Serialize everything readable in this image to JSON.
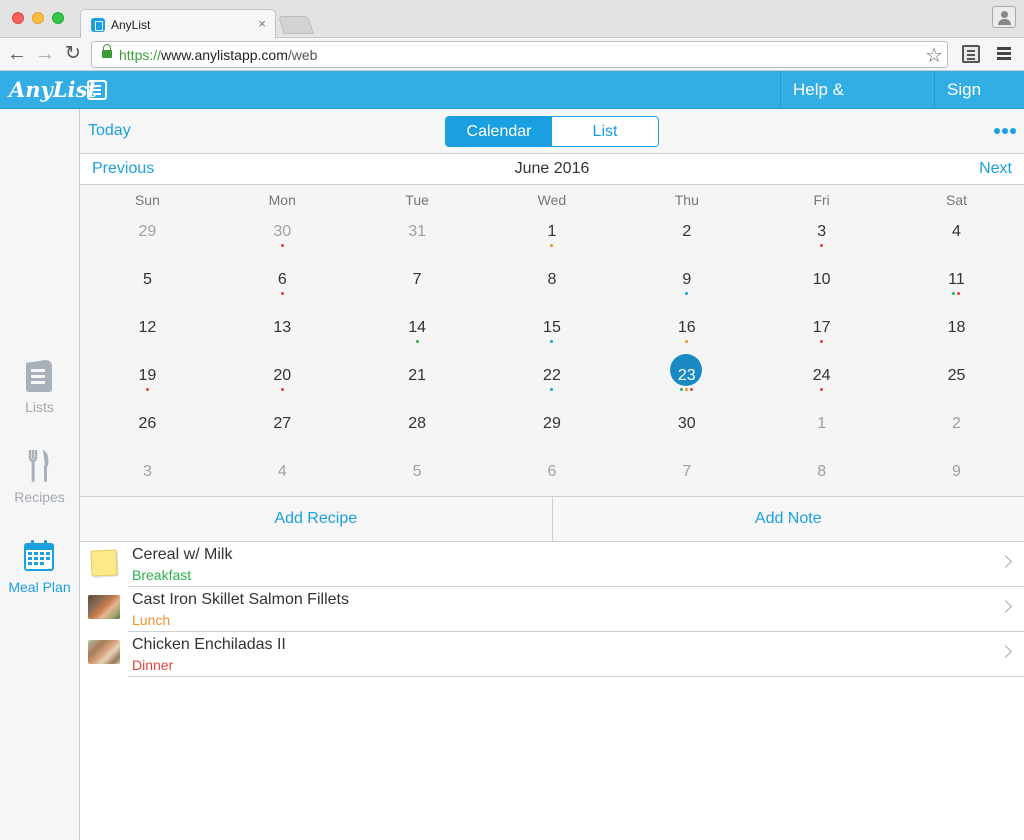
{
  "browser": {
    "tab_title": "AnyList",
    "tab_close": "×",
    "url_scheme": "https://",
    "url_host": "www.anylistapp.com",
    "url_path": "/web"
  },
  "header": {
    "logo_text": "AnyList",
    "help_label": "Help & Feedback",
    "signout_label": "Sign Out",
    "accent_color": "#33aee5"
  },
  "sidebar": {
    "items": [
      {
        "label": "Lists",
        "icon": "lists-icon",
        "active": false
      },
      {
        "label": "Recipes",
        "icon": "fork-knife-icon",
        "active": false
      },
      {
        "label": "Meal Plan",
        "icon": "calendar-icon",
        "active": true
      }
    ]
  },
  "toolbar": {
    "today_label": "Today",
    "segments": [
      {
        "label": "Calendar",
        "active": true
      },
      {
        "label": "List",
        "active": false
      }
    ],
    "more_icon": "more-dots-icon"
  },
  "month_nav": {
    "previous_label": "Previous",
    "title": "June 2016",
    "next_label": "Next"
  },
  "calendar": {
    "weekdays": [
      "Sun",
      "Mon",
      "Tue",
      "Wed",
      "Thu",
      "Fri",
      "Sat"
    ],
    "selected_day": "23",
    "weeks": [
      [
        {
          "day": "29",
          "other": true,
          "dots": []
        },
        {
          "day": "30",
          "other": true,
          "dots": [
            "#e0433b"
          ]
        },
        {
          "day": "31",
          "other": true,
          "dots": []
        },
        {
          "day": "1",
          "other": false,
          "dots": [
            "#f0932b"
          ]
        },
        {
          "day": "2",
          "other": false,
          "dots": []
        },
        {
          "day": "3",
          "other": false,
          "dots": [
            "#e0433b"
          ]
        },
        {
          "day": "4",
          "other": false,
          "dots": []
        }
      ],
      [
        {
          "day": "5",
          "other": false,
          "dots": []
        },
        {
          "day": "6",
          "other": false,
          "dots": [
            "#e0433b"
          ]
        },
        {
          "day": "7",
          "other": false,
          "dots": []
        },
        {
          "day": "8",
          "other": false,
          "dots": []
        },
        {
          "day": "9",
          "other": false,
          "dots": [
            "#1a9fe0"
          ]
        },
        {
          "day": "10",
          "other": false,
          "dots": []
        },
        {
          "day": "11",
          "other": false,
          "dots": [
            "#2bb24c",
            "#e0433b"
          ]
        }
      ],
      [
        {
          "day": "12",
          "other": false,
          "dots": []
        },
        {
          "day": "13",
          "other": false,
          "dots": []
        },
        {
          "day": "14",
          "other": false,
          "dots": [
            "#2bb24c"
          ]
        },
        {
          "day": "15",
          "other": false,
          "dots": [
            "#1a9fe0"
          ]
        },
        {
          "day": "16",
          "other": false,
          "dots": [
            "#f0932b"
          ]
        },
        {
          "day": "17",
          "other": false,
          "dots": [
            "#e0433b"
          ]
        },
        {
          "day": "18",
          "other": false,
          "dots": []
        }
      ],
      [
        {
          "day": "19",
          "other": false,
          "dots": [
            "#e0433b"
          ]
        },
        {
          "day": "20",
          "other": false,
          "dots": [
            "#e0433b"
          ]
        },
        {
          "day": "21",
          "other": false,
          "dots": []
        },
        {
          "day": "22",
          "other": false,
          "dots": [
            "#1a9fe0"
          ]
        },
        {
          "day": "23",
          "other": false,
          "dots": [
            "#2bb24c",
            "#f0932b",
            "#e0433b"
          ]
        },
        {
          "day": "24",
          "other": false,
          "dots": [
            "#e0433b"
          ]
        },
        {
          "day": "25",
          "other": false,
          "dots": []
        }
      ],
      [
        {
          "day": "26",
          "other": false,
          "dots": []
        },
        {
          "day": "27",
          "other": false,
          "dots": []
        },
        {
          "day": "28",
          "other": false,
          "dots": []
        },
        {
          "day": "29",
          "other": false,
          "dots": []
        },
        {
          "day": "30",
          "other": false,
          "dots": []
        },
        {
          "day": "1",
          "other": true,
          "dots": []
        },
        {
          "day": "2",
          "other": true,
          "dots": []
        }
      ],
      [
        {
          "day": "3",
          "other": true,
          "dots": []
        },
        {
          "day": "4",
          "other": true,
          "dots": []
        },
        {
          "day": "5",
          "other": true,
          "dots": []
        },
        {
          "day": "6",
          "other": true,
          "dots": []
        },
        {
          "day": "7",
          "other": true,
          "dots": []
        },
        {
          "day": "8",
          "other": true,
          "dots": []
        },
        {
          "day": "9",
          "other": true,
          "dots": []
        }
      ]
    ]
  },
  "actions": {
    "add_recipe_label": "Add Recipe",
    "add_note_label": "Add Note"
  },
  "meals": [
    {
      "name": "Cereal w/ Milk",
      "type": "Breakfast",
      "type_color": "#2bb24c",
      "thumb": "note"
    },
    {
      "name": "Cast Iron Skillet Salmon Fillets",
      "type": "Lunch",
      "type_color": "#f0932b",
      "thumb": "photo-salmon"
    },
    {
      "name": "Chicken Enchiladas II",
      "type": "Dinner",
      "type_color": "#e0433b",
      "thumb": "photo-enchilada"
    }
  ]
}
